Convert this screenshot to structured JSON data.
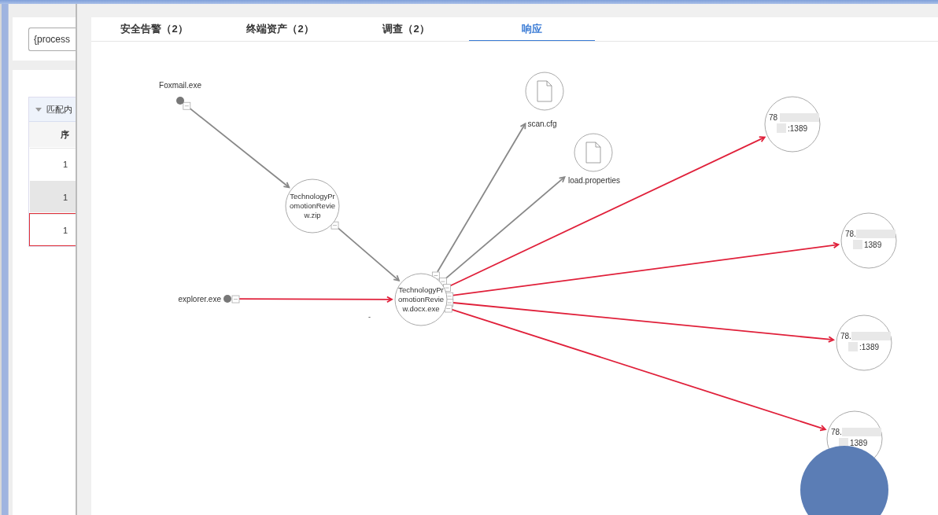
{
  "background_page": {
    "search_field": {
      "value": "{process"
    },
    "table": {
      "group_header": "匹配内",
      "columns": [
        "序"
      ],
      "rows": [
        {
          "cells": [
            "1"
          ],
          "selected": false,
          "flagged": false
        },
        {
          "cells": [
            "1"
          ],
          "selected": true,
          "flagged": false
        },
        {
          "cells": [
            "1"
          ],
          "selected": false,
          "flagged": true
        }
      ]
    }
  },
  "tabs": [
    {
      "label": "安全告警（2）",
      "selected": false
    },
    {
      "label": "终端资产（2）",
      "selected": false
    },
    {
      "label": "调查（2）",
      "selected": false
    },
    {
      "label": "响应",
      "selected": true
    }
  ],
  "graph": {
    "nodes": [
      {
        "kind": "process",
        "lines": [
          "Foxmail.exe"
        ]
      },
      {
        "kind": "circle",
        "lines": [
          "TechnologyPr",
          "omotionRevie",
          "w.zip"
        ]
      },
      {
        "kind": "process",
        "lines": [
          "explorer.exe"
        ]
      },
      {
        "kind": "circle",
        "lines": [
          "TechnologyPr",
          "omotionRevie",
          "w.docx.exe"
        ]
      },
      {
        "kind": "file",
        "lines": [
          "scan.cfg"
        ]
      },
      {
        "kind": "file",
        "lines": [
          "load.properties"
        ]
      },
      {
        "kind": "circle",
        "lines": [
          "78",
          ":1389"
        ]
      },
      {
        "kind": "circle",
        "lines": [
          "78.",
          "1389"
        ]
      },
      {
        "kind": "circle",
        "lines": [
          "78.",
          ":1389"
        ]
      },
      {
        "kind": "circle",
        "lines": [
          "78.",
          "1389"
        ]
      }
    ],
    "edges": [
      {
        "color": "#888888"
      },
      {
        "color": "#888888"
      },
      {
        "color": "#e0203a"
      },
      {
        "color": "#888888"
      },
      {
        "color": "#888888"
      },
      {
        "color": "#e0203a"
      },
      {
        "color": "#e0203a"
      },
      {
        "color": "#e0203a"
      },
      {
        "color": "#e0203a"
      }
    ],
    "stray_mark": "-"
  }
}
